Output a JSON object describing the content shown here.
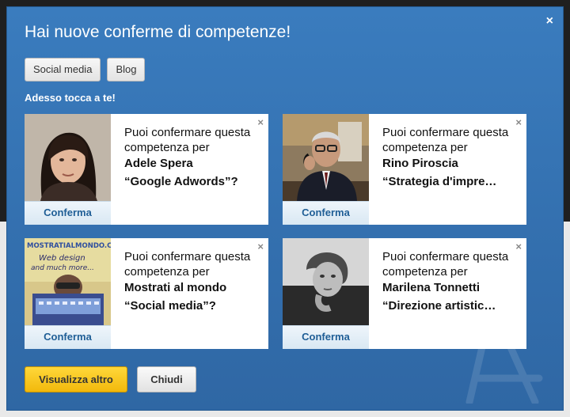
{
  "dialog": {
    "title": "Hai nuove conferme di competenze!",
    "close_glyph": "×",
    "tags": [
      "Social media",
      "Blog"
    ],
    "subtitle": "Adesso tocca a te!"
  },
  "cards": [
    {
      "prompt": "Puoi confermare questa competenza per",
      "person": "Adele Spera",
      "skill": "“Google Adwords”?",
      "confirm_label": "Conferma",
      "dismiss_glyph": "×"
    },
    {
      "prompt": "Puoi confermare questa competenza per",
      "person": "Rino Piroscia",
      "skill": "“Strategia d'impre…",
      "confirm_label": "Conferma",
      "dismiss_glyph": "×"
    },
    {
      "prompt": "Puoi confermare questa competenza per",
      "person": "Mostrati al mondo",
      "skill": "“Social media”?",
      "confirm_label": "Conferma",
      "dismiss_glyph": "×",
      "photo_text": [
        "MOSTRATIALMONDO.COM",
        "Web design",
        "and much more..."
      ]
    },
    {
      "prompt": "Puoi confermare questa competenza per",
      "person": "Marilena Tonnetti",
      "skill": "“Direzione artistic…",
      "confirm_label": "Conferma",
      "dismiss_glyph": "×"
    }
  ],
  "footer": {
    "primary_label": "Visualizza altro",
    "secondary_label": "Chiudi"
  },
  "colors": {
    "modal_bg": "#3577b8",
    "primary_button": "#f5c518",
    "link": "#1f5e96"
  }
}
